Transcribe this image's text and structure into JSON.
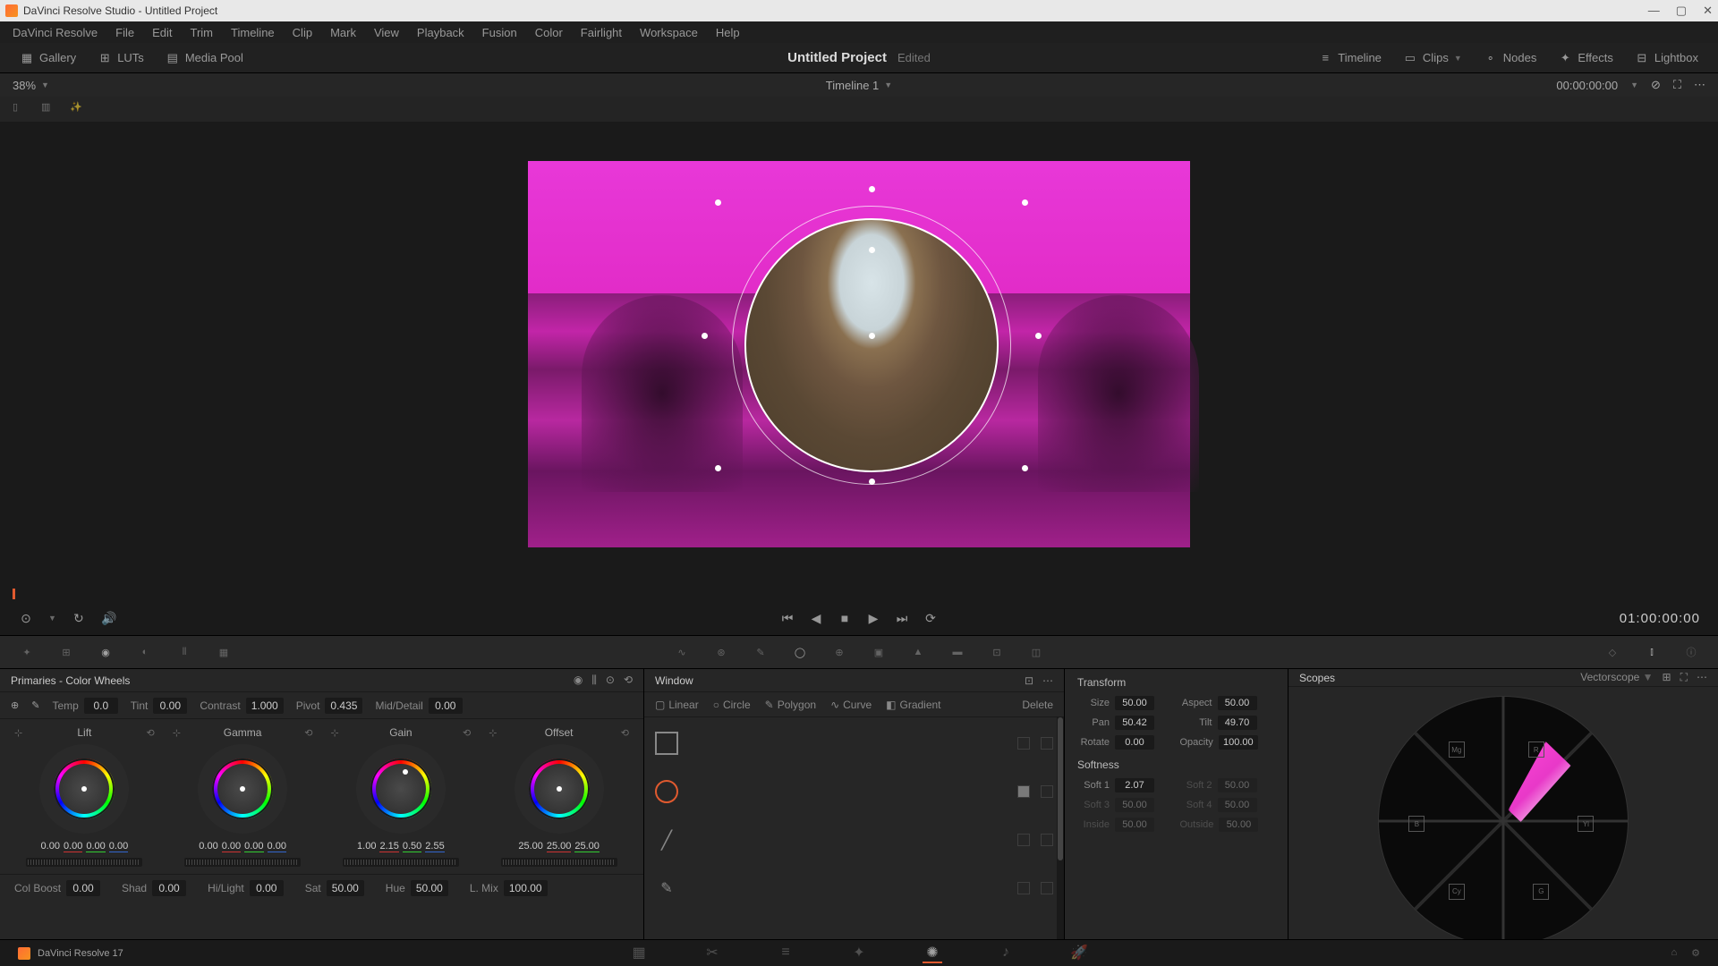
{
  "titlebar": {
    "text": "DaVinci Resolve Studio - Untitled Project"
  },
  "menubar": [
    "DaVinci Resolve",
    "File",
    "Edit",
    "Trim",
    "Timeline",
    "Clip",
    "Mark",
    "View",
    "Playback",
    "Fusion",
    "Color",
    "Fairlight",
    "Workspace",
    "Help"
  ],
  "toolbar": {
    "left": [
      {
        "icon": "grid",
        "label": "Gallery"
      },
      {
        "icon": "luts",
        "label": "LUTs"
      },
      {
        "icon": "media",
        "label": "Media Pool"
      }
    ],
    "project_title": "Untitled Project",
    "edited": "Edited",
    "right": [
      {
        "icon": "timeline",
        "label": "Timeline"
      },
      {
        "icon": "clips",
        "label": "Clips"
      },
      {
        "icon": "nodes",
        "label": "Nodes"
      },
      {
        "icon": "fx",
        "label": "Effects"
      },
      {
        "icon": "lightbox",
        "label": "Lightbox"
      }
    ]
  },
  "subbar": {
    "zoom": "38%",
    "timeline": "Timeline 1",
    "timecode": "00:00:00:00"
  },
  "transport": {
    "tc": "01:00:00:00"
  },
  "primaries": {
    "title": "Primaries - Color Wheels",
    "row1": [
      {
        "lbl": "Temp",
        "val": "0.0"
      },
      {
        "lbl": "Tint",
        "val": "0.00"
      },
      {
        "lbl": "Contrast",
        "val": "1.000"
      },
      {
        "lbl": "Pivot",
        "val": "0.435"
      },
      {
        "lbl": "Mid/Detail",
        "val": "0.00"
      }
    ],
    "wheels": [
      {
        "name": "Lift",
        "vals": [
          "0.00",
          "0.00",
          "0.00",
          "0.00"
        ]
      },
      {
        "name": "Gamma",
        "vals": [
          "0.00",
          "0.00",
          "0.00",
          "0.00"
        ]
      },
      {
        "name": "Gain",
        "vals": [
          "1.00",
          "2.15",
          "0.50",
          "2.55"
        ]
      },
      {
        "name": "Offset",
        "vals": [
          "25.00",
          "25.00",
          "25.00"
        ]
      }
    ],
    "row2": [
      {
        "lbl": "Col Boost",
        "val": "0.00"
      },
      {
        "lbl": "Shad",
        "val": "0.00"
      },
      {
        "lbl": "Hi/Light",
        "val": "0.00"
      },
      {
        "lbl": "Sat",
        "val": "50.00"
      },
      {
        "lbl": "Hue",
        "val": "50.00"
      },
      {
        "lbl": "L. Mix",
        "val": "100.00"
      }
    ]
  },
  "window": {
    "title": "Window",
    "shapes": [
      "Linear",
      "Circle",
      "Polygon",
      "Curve",
      "Gradient"
    ],
    "delete": "Delete"
  },
  "transform": {
    "title": "Transform",
    "fields": [
      [
        {
          "lbl": "Size",
          "val": "50.00"
        },
        {
          "lbl": "Aspect",
          "val": "50.00"
        }
      ],
      [
        {
          "lbl": "Pan",
          "val": "50.42"
        },
        {
          "lbl": "Tilt",
          "val": "49.70"
        }
      ],
      [
        {
          "lbl": "Rotate",
          "val": "0.00"
        },
        {
          "lbl": "Opacity",
          "val": "100.00"
        }
      ]
    ],
    "softness_title": "Softness",
    "softness": [
      [
        {
          "lbl": "Soft 1",
          "val": "2.07",
          "active": true
        },
        {
          "lbl": "Soft 2",
          "val": "50.00",
          "active": false
        }
      ],
      [
        {
          "lbl": "Soft 3",
          "val": "50.00",
          "active": false
        },
        {
          "lbl": "Soft 4",
          "val": "50.00",
          "active": false
        }
      ],
      [
        {
          "lbl": "Inside",
          "val": "50.00",
          "active": false
        },
        {
          "lbl": "Outside",
          "val": "50.00",
          "active": false
        }
      ]
    ]
  },
  "scopes": {
    "title": "Scopes",
    "type": "Vectorscope"
  },
  "pagebar": {
    "app": "DaVinci Resolve 17"
  }
}
